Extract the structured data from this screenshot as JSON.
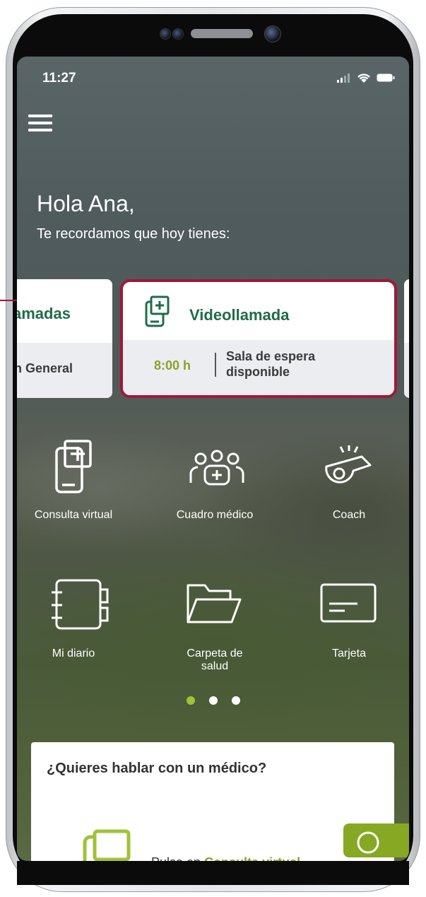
{
  "status_bar": {
    "time": "11:27"
  },
  "greeting": {
    "title": "Hola Ana,",
    "subtitle": "Te recordamos que hoy tienes:"
  },
  "cards": {
    "left": {
      "title": "amadas",
      "subtitle": "n General"
    },
    "main": {
      "title": "Videollamada",
      "time": "8:00 h",
      "status": "Sala de espera disponible",
      "highlight_color": "#a0183a"
    }
  },
  "menu": [
    {
      "label": "Consulta virtual",
      "icon": "consulta-virtual-icon"
    },
    {
      "label": "Cuadro médico",
      "icon": "cuadro-medico-icon"
    },
    {
      "label": "Coach",
      "icon": "coach-whistle-icon"
    },
    {
      "label": "Mi diario",
      "icon": "notebook-icon"
    },
    {
      "label": "Carpeta de salud",
      "icon": "folder-icon"
    },
    {
      "label": "Tarjeta",
      "icon": "card-icon"
    }
  ],
  "pagination": {
    "pages": 3,
    "active": 1
  },
  "bottom_card": {
    "title": "¿Quieres hablar con un médico?",
    "hint_prefix": "Pulsa en ",
    "hint_link": "Consulta virtual"
  },
  "colors": {
    "brand_green": "#1f6b4a",
    "accent_green": "#8aa22a",
    "highlight": "#a0183a"
  }
}
